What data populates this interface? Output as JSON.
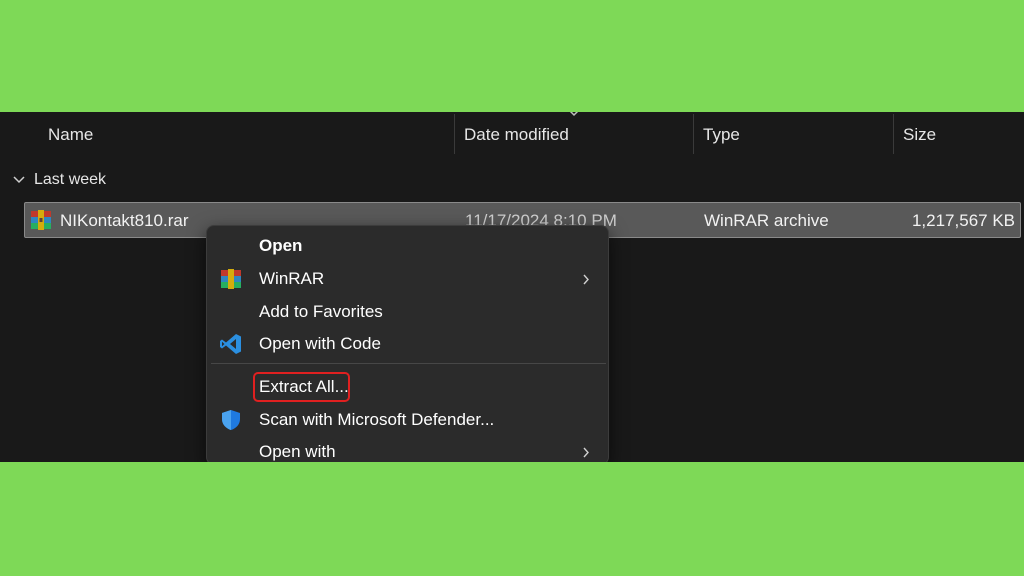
{
  "columns": {
    "name": "Name",
    "date_modified": "Date modified",
    "type": "Type",
    "size": "Size"
  },
  "group": {
    "label": "Last week"
  },
  "file": {
    "name": "NIKontakt810.rar",
    "date": "11/17/2024 8:10 PM",
    "type": "WinRAR archive",
    "size": "1,217,567 KB",
    "icon": "winrar-archive-icon"
  },
  "context_menu": {
    "items": [
      {
        "label": "Open",
        "bold": true
      },
      {
        "label": "WinRAR",
        "icon": "winrar-icon",
        "submenu": true
      },
      {
        "label": "Add to Favorites"
      },
      {
        "label": "Open with Code",
        "icon": "vscode-icon"
      },
      {
        "label": "Extract All...",
        "highlighted": true
      },
      {
        "label": "Scan with Microsoft Defender...",
        "icon": "defender-shield-icon"
      },
      {
        "label": "Open with",
        "submenu": true
      }
    ]
  },
  "colors": {
    "background": "#7ed957",
    "explorer_bg": "#191919",
    "menu_bg": "#2b2b2b",
    "selection_bg": "#595959",
    "highlight_border": "#e02020",
    "vscode_blue": "#2b8fe0",
    "defender_blue": "#1f7ae0"
  }
}
